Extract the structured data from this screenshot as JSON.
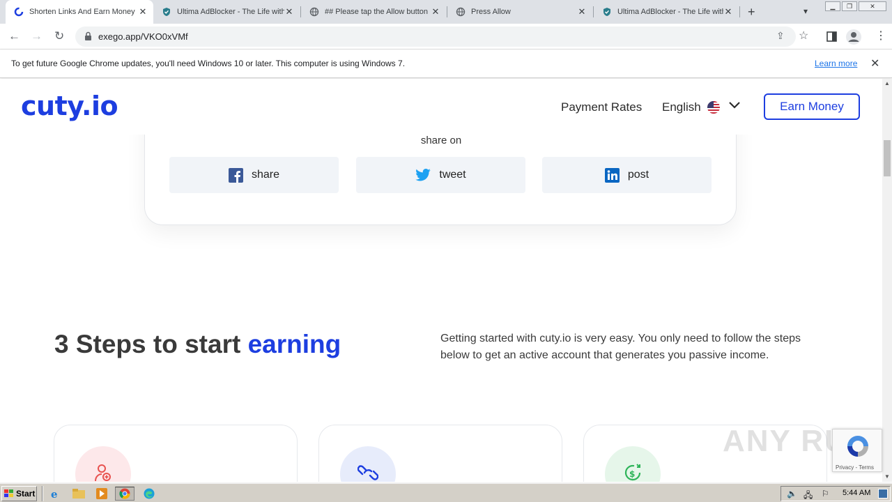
{
  "browser": {
    "tabs": [
      {
        "title": "Shorten Links And Earn Money",
        "icon": "cuty-favicon",
        "active": true
      },
      {
        "title": "Ultima AdBlocker - The Life with",
        "icon": "shield-favicon",
        "active": false
      },
      {
        "title": "## Please tap the Allow button",
        "icon": "globe-favicon",
        "active": false
      },
      {
        "title": "Press Allow",
        "icon": "globe-favicon",
        "active": false
      },
      {
        "title": "Ultima AdBlocker - The Life with",
        "icon": "shield-favicon",
        "active": false
      }
    ],
    "url": "exego.app/VKO0xVMf"
  },
  "infobar": {
    "message": "To get future Google Chrome updates, you'll need Windows 10 or later. This computer is using Windows 7.",
    "link": "Learn more"
  },
  "site": {
    "logo": "cuty.io",
    "nav": {
      "payment_rates": "Payment Rates",
      "language": "English",
      "cta": "Earn Money"
    },
    "share": {
      "heading": "share on",
      "buttons": [
        {
          "label": "share",
          "icon": "facebook-icon"
        },
        {
          "label": "tweet",
          "icon": "twitter-icon"
        },
        {
          "label": "post",
          "icon": "linkedin-icon"
        }
      ]
    },
    "steps": {
      "title_prefix": "3 Steps to start ",
      "title_accent": "earning",
      "description": "Getting started with cuty.io is very easy. You only need to follow the steps below to get an active account that generates you passive income.",
      "cards": [
        {
          "icon": "user-add-icon",
          "color": "#fde8ea"
        },
        {
          "icon": "link-icon",
          "color": "#e7ecfb"
        },
        {
          "icon": "money-icon",
          "color": "#e6f6ea"
        }
      ]
    }
  },
  "overlay": {
    "watermark": "ANY RUN",
    "recaptcha": "Privacy - Terms"
  },
  "taskbar": {
    "start": "Start",
    "clock": "5:44 AM"
  },
  "colors": {
    "brand": "#1d3ee0",
    "facebook": "#3b5998",
    "twitter": "#1da1f2",
    "linkedin": "#0a66c2"
  }
}
